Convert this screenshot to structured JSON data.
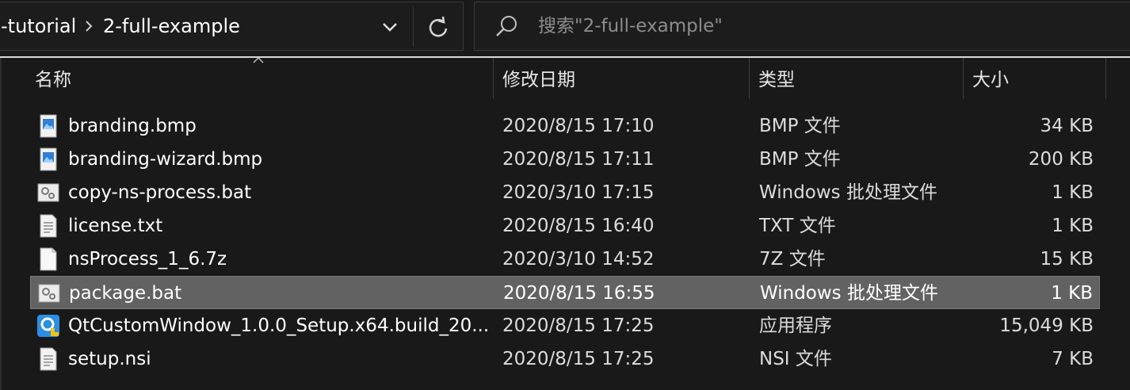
{
  "address_bar": {
    "parent_folder": "-tutorial",
    "current_folder": "2-full-example",
    "dropdown_icon": "chevron-down-icon",
    "refresh_icon": "refresh-icon"
  },
  "search": {
    "placeholder": "搜索\"2-full-example\"",
    "icon": "search-icon"
  },
  "columns": {
    "name": "名称",
    "date": "修改日期",
    "type": "类型",
    "size": "大小"
  },
  "files": [
    {
      "name": "branding.bmp",
      "date": "2020/8/15 17:10",
      "type": "BMP 文件",
      "size": "34 KB",
      "icon": "image-file-icon",
      "selected": false
    },
    {
      "name": "branding-wizard.bmp",
      "date": "2020/8/15 17:11",
      "type": "BMP 文件",
      "size": "200 KB",
      "icon": "image-file-icon",
      "selected": false
    },
    {
      "name": "copy-ns-process.bat",
      "date": "2020/3/10 17:15",
      "type": "Windows 批处理文件",
      "size": "1 KB",
      "icon": "batch-file-icon",
      "selected": false
    },
    {
      "name": "license.txt",
      "date": "2020/8/15 16:40",
      "type": "TXT 文件",
      "size": "1 KB",
      "icon": "text-file-icon",
      "selected": false
    },
    {
      "name": "nsProcess_1_6.7z",
      "date": "2020/3/10 14:52",
      "type": "7Z 文件",
      "size": "15 KB",
      "icon": "blank-file-icon",
      "selected": false
    },
    {
      "name": "package.bat",
      "date": "2020/8/15 16:55",
      "type": "Windows 批处理文件",
      "size": "1 KB",
      "icon": "batch-file-icon",
      "selected": true
    },
    {
      "name": "QtCustomWindow_1.0.0_Setup.x64.build_20...",
      "date": "2020/8/15 17:25",
      "type": "应用程序",
      "size": "15,049 KB",
      "icon": "installer-icon",
      "selected": false
    },
    {
      "name": "setup.nsi",
      "date": "2020/8/15 17:25",
      "type": "NSI 文件",
      "size": "7 KB",
      "icon": "text-file-icon",
      "selected": false
    }
  ]
}
